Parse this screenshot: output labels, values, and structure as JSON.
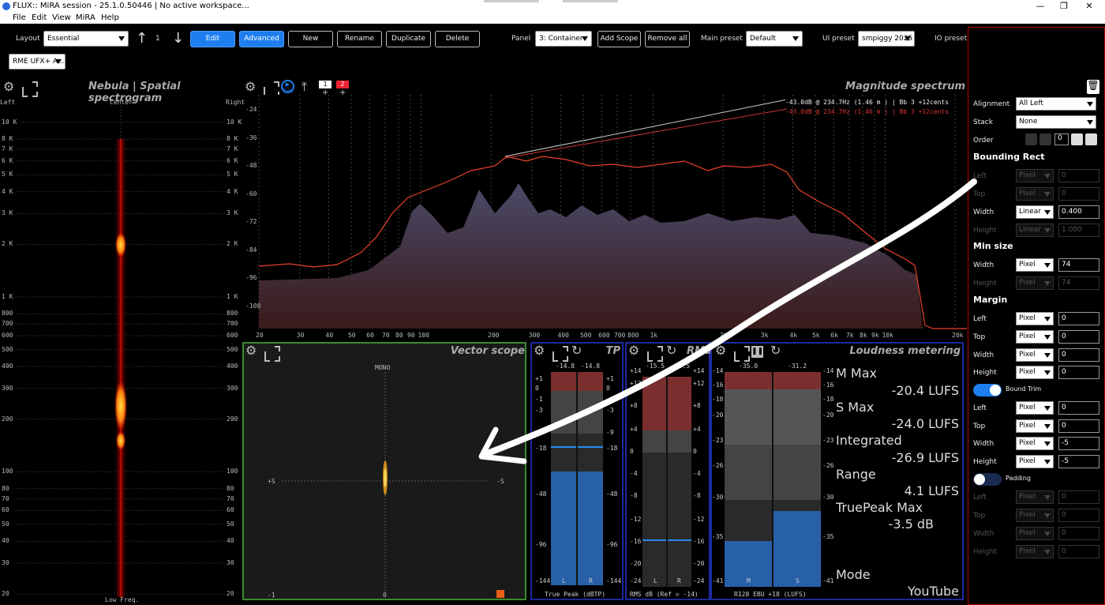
{
  "titlebar": {
    "title": "FLUX:: MiRA session - 25.1.0.50446 | No active workspace...",
    "minimize": "—",
    "restore": "❐",
    "close": "✕"
  },
  "menu": [
    "File",
    "Edit",
    "View",
    "MiRA",
    "Help"
  ],
  "toolbar": {
    "layout_label": "Layout",
    "layout_value": "Essential",
    "layout_index": "1",
    "edit": "Edit",
    "advanced": "Advanced",
    "new": "New",
    "rename": "Rename",
    "duplicate": "Duplicate",
    "delete": "Delete",
    "panel_label": "Panel",
    "panel_value": "3: Container",
    "add_scope": "Add Scope",
    "remove_all": "Remove all",
    "main_preset_label": "Main preset",
    "main_preset_value": "Default",
    "ui_preset_label": "UI preset",
    "ui_preset_value": "smpiggy 2025",
    "io_preset_label": "IO preset",
    "io_device": "RME UFX+ A..."
  },
  "nebula": {
    "title": "Nebula | Spatial spectrogram",
    "left": "Left",
    "center": "Center",
    "right": "Right",
    "bottom": "Low Freq.",
    "ticks": [
      "10 K",
      "8 K",
      "7 K",
      "6 K",
      "5 K",
      "4 K",
      "3 K",
      "2 K",
      "1 K",
      "800",
      "700",
      "600",
      "500",
      "400",
      "300",
      "200",
      "100",
      "80",
      "70",
      "60",
      "50",
      "40",
      "30",
      "20"
    ]
  },
  "spectrum": {
    "title": "Magnitude spectrum",
    "live": "live",
    "badge1": "1",
    "badge2": "2",
    "readout1": "-43.0dB @    234.7Hz (1.46 m ) | Bb 3 +12cents",
    "readout2": "-43.0dB @    234.7Hz (1.46 m ) | Bb 3 +12cents",
    "yticks": [
      "-24",
      "-36",
      "-48",
      "-60",
      "-72",
      "-84",
      "-96",
      "-108"
    ],
    "xticks": [
      "20",
      "30",
      "40",
      "50",
      "60",
      "70",
      "80",
      "90",
      "100",
      "200",
      "300",
      "400",
      "500",
      "600",
      "700",
      "800",
      "1k",
      "2k",
      "3k",
      "4k",
      "5k",
      "6k",
      "7k",
      "8k",
      "9k",
      "10k",
      "20k"
    ]
  },
  "vector": {
    "title": "Vector scope",
    "mono": "MONO",
    "plus_s": "+S",
    "minus_s": "-S",
    "b_left": "-1",
    "b_mid": "0"
  },
  "tp": {
    "title": "TP",
    "v_l": "-14.8",
    "v_r": "-14.8",
    "ticks": [
      "+1",
      "0",
      "-1",
      "-3",
      "-9",
      "-18",
      "-48",
      "-96",
      "-144"
    ],
    "ch_l": "L",
    "ch_r": "R",
    "footer": "True Peak (dBTP)",
    "level": 0.47
  },
  "rms": {
    "title": "RMS",
    "v_l": "-15.5",
    "v_r": "-15.5",
    "ticks": [
      "+14",
      "+12",
      "+8",
      "+4",
      "0",
      "-4",
      "-8",
      "-12",
      "-16",
      "-20",
      "-24"
    ],
    "ch_l": "L",
    "ch_r": "R",
    "footer": "RMS dB (Ref = -14)"
  },
  "loudness": {
    "title": "Loudness metering",
    "v_m": "-35.0",
    "v_s": "-31.2",
    "ticks": [
      "-14",
      "-16",
      "-18",
      "-20",
      "-23",
      "-26",
      "-30",
      "-35",
      "-41"
    ],
    "ch_m": "M",
    "ch_s": "S",
    "footer": "R128 EBU +18 (LUFS)",
    "m_max_label": "M Max",
    "m_max": "-20.4 LUFS",
    "s_max_label": "S Max",
    "s_max": "-24.0 LUFS",
    "integrated_label": "Integrated",
    "integrated": "-26.9 LUFS",
    "range_label": "Range",
    "range": "4.1 LUFS",
    "truepeak_label": "TruePeak Max",
    "truepeak": "-3.5 dB",
    "mode_label": "Mode",
    "mode": "YouTube"
  },
  "props": {
    "alignment_label": "Alignment",
    "alignment": "All Left",
    "stack_label": "Stack",
    "stack": "None",
    "order_label": "Order",
    "order": "0",
    "bounding_rect": "Bounding Rect",
    "left": "Left",
    "top": "Top",
    "width": "Width",
    "height": "Height",
    "pixel": "Pixel",
    "linear": "Linear",
    "zero": "0",
    "br_width": "0.400",
    "br_height": "1.000",
    "min_size": "Min size",
    "min_w": "74",
    "min_h": "74",
    "margin": "Margin",
    "bound_trim": "Bound Trim",
    "bt_w": "-5",
    "bt_h": "-5",
    "padding": "Padding"
  },
  "colors": {
    "accent": "#1e7ef0",
    "red": "#c8352a",
    "panel_green": "#3c8a30",
    "panel_blue": "#1c2aa0"
  }
}
